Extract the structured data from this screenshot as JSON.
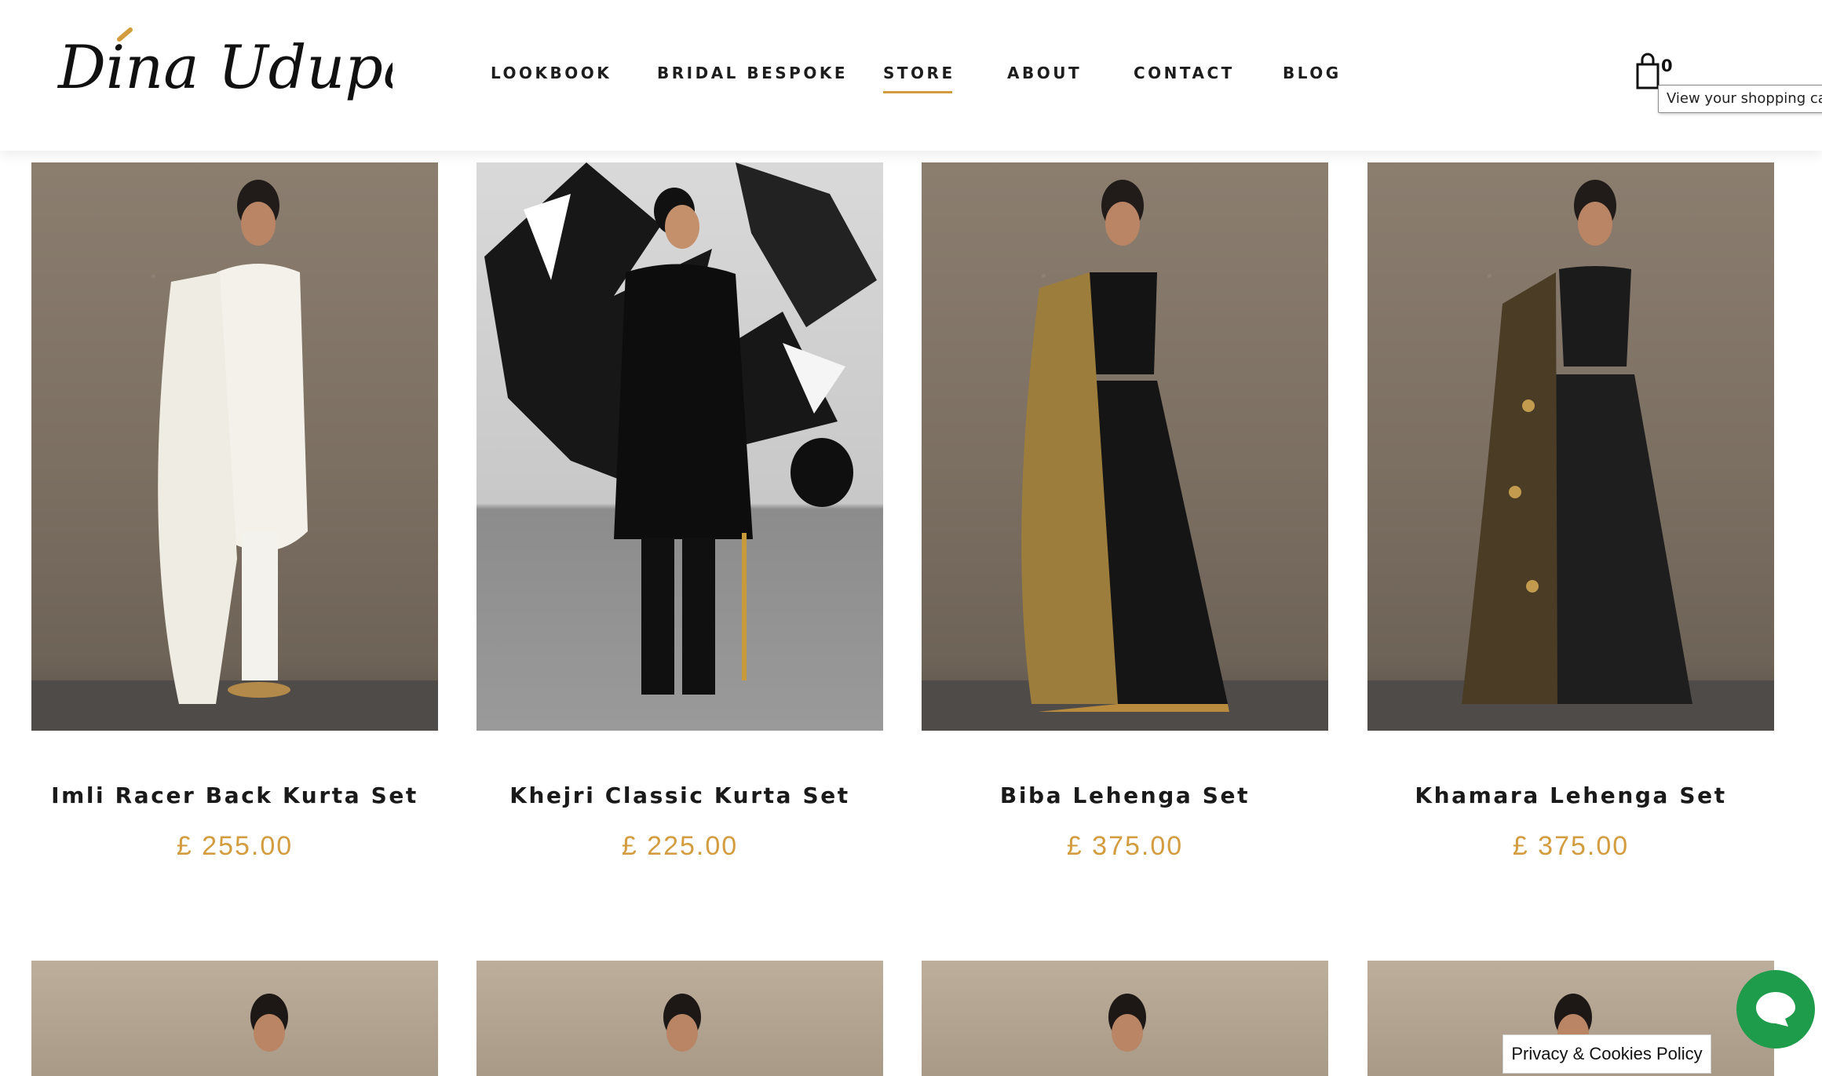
{
  "brand": {
    "logo_text": "Dina Udupa",
    "accent_color": "#d39c3f"
  },
  "nav": {
    "items": [
      {
        "label": "LOOKBOOK",
        "active": false
      },
      {
        "label": "BRIDAL BESPOKE",
        "active": false
      },
      {
        "label": "STORE",
        "active": true
      },
      {
        "label": "ABOUT",
        "active": false
      },
      {
        "label": "CONTACT",
        "active": false
      },
      {
        "label": "BLOG",
        "active": false
      }
    ]
  },
  "cart": {
    "icon": "shopping-bag-icon",
    "count": "0",
    "tooltip": "View your shopping cart"
  },
  "products": [
    {
      "name": "Imli Racer Back Kurta Set",
      "price": "£ 255.00",
      "image": "model in white kurta with dupatta"
    },
    {
      "name": "Khejri Classic Kurta Set",
      "price": "£ 225.00",
      "image": "model in black kurta set against graffiti wall"
    },
    {
      "name": "Biba Lehenga Set",
      "price": "£ 375.00",
      "image": "model in black lehenga with gold dupatta"
    },
    {
      "name": "Khamara Lehenga Set",
      "price": "£ 375.00",
      "image": "model in black lehenga with printed dupatta"
    }
  ],
  "chat": {
    "icon": "chat-icon",
    "color": "#1e9b4b"
  },
  "privacy": {
    "label": "Privacy & Cookies Policy"
  }
}
